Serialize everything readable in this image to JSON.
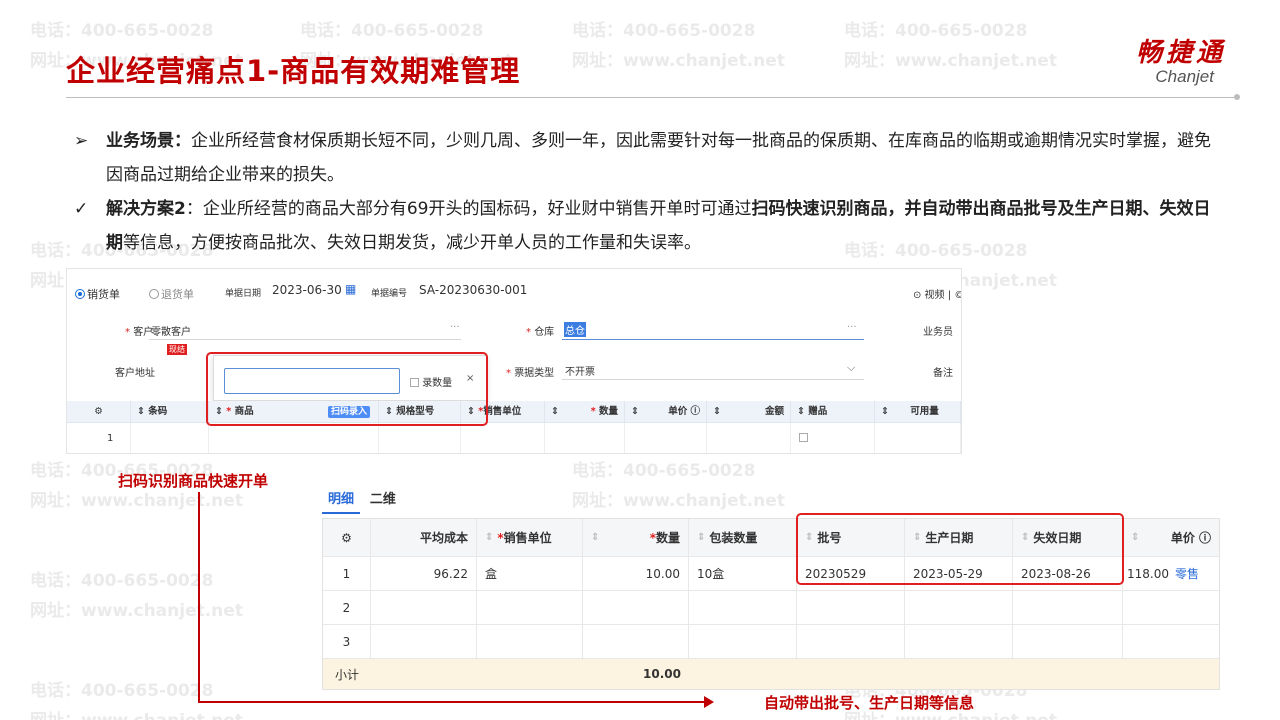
{
  "watermark": {
    "phone": "电话：400-665-0028",
    "site": "网址：www.chanjet.net"
  },
  "header": {
    "title": "企业经营痛点1-商品有效期难管理"
  },
  "logo": {
    "cn": "畅捷通",
    "en": "Chanjet"
  },
  "bullets": {
    "b1_mark": "➢",
    "b1_label": "业务场景：",
    "b1_text": "企业所经营食材保质期长短不同，少则几周、多则一年，因此需要针对每一批商品的保质期、在库商品的临期或逾期情况实时掌握，避免因商品过期给企业带来的损失。",
    "b2_mark": "✓",
    "b2_label": "解决方案2",
    "b2_text1": "：企业所经营的商品大部分有69开头的国标码，好业财中销售开单时可通过",
    "b2_bold": "扫码快速识别商品，并自动带出商品批号及生产日期、失效日期",
    "b2_text2": "等信息，方便按商品批次、失效日期发货，减少开单人员的工作量和失误率。"
  },
  "order_form": {
    "radio_sale": "销货单",
    "radio_return": "退货单",
    "date_label": "单据日期",
    "date_value": "2023-06-30",
    "no_label": "单据编号",
    "no_value": "SA-20230630-001",
    "video": "⊙ 视频 | ©",
    "customer_label": "客户",
    "customer_value": "零散客户",
    "customer_tag": "现结",
    "more": "···",
    "warehouse_label": "仓库",
    "warehouse_value": "总仓",
    "salesman_label": "业务员",
    "address_label": "客户地址",
    "invoice_label": "票据类型",
    "invoice_value": "不开票",
    "remark_label": "备注",
    "popup_checkbox": "录数量",
    "popup_close": "×",
    "columns": [
      "条码",
      "商品",
      "扫码录入",
      "规格型号",
      "销售单位",
      "数量",
      "单价 ⓘ",
      "金额",
      "赠品",
      "可用量"
    ],
    "row_no": "1"
  },
  "detail": {
    "tabs": [
      "明细",
      "二维"
    ],
    "columns": [
      "平均成本",
      "销售单位",
      "数量",
      "包装数量",
      "批号",
      "生产日期",
      "失效日期",
      "单价 ⓘ"
    ],
    "rows": [
      {
        "no": "1",
        "avg_cost": "96.22",
        "unit": "盒",
        "qty": "10.00",
        "pack": "10盒",
        "batch": "20230529",
        "mfg": "2023-05-29",
        "exp": "2023-08-26",
        "price": "118.00",
        "price_link": "零售"
      },
      {
        "no": "2"
      },
      {
        "no": "3"
      }
    ],
    "total_label": "小计",
    "total_qty": "10.00"
  },
  "annotations": {
    "scan": "扫码识别商品快速开单",
    "auto": "自动带出批号、生产日期等信息"
  },
  "colors": {
    "accent": "#c00000",
    "link": "#2a6ad8",
    "highlight": "#e02020"
  }
}
